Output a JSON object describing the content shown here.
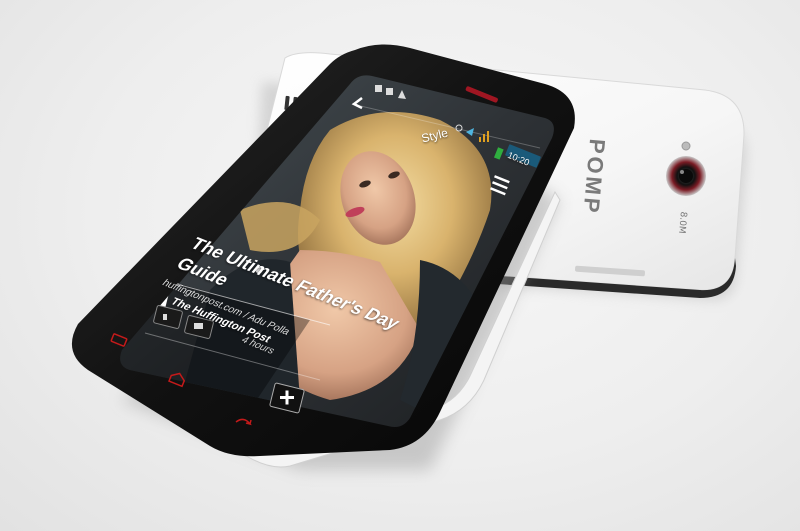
{
  "front_phone": {
    "status_bar": {
      "time": "10:20",
      "icons": [
        "notification-icon",
        "image-icon",
        "warning-icon",
        "alarm-icon",
        "wifi-icon",
        "signal-icon",
        "battery-icon"
      ]
    },
    "app_bar": {
      "back_icon": "back-arrow-icon",
      "section_label": "Style",
      "menu_icon": "hamburger-menu-icon"
    },
    "article": {
      "title_line1": "The Ultimate Father's Day",
      "title_line2": "Guide",
      "source_line": "huffingtonpost.com / Adu Polla",
      "publisher": "The Huffington Post",
      "time_ago": "4 hours",
      "pager_dot_icon": "page-indicator-icon",
      "like_icon": "like-icon",
      "comment_icon": "comment-icon",
      "add_icon": "plus-icon"
    },
    "nav_keys": [
      "menu-key-icon",
      "home-key-icon",
      "back-key-icon"
    ]
  },
  "back_phone": {
    "brand": "POMP",
    "camera_label": "8.0M"
  },
  "colors": {
    "front_bezel": "#111111",
    "back_shell": "#ffffff",
    "nav_key_red": "#c41a1a",
    "status_time_bg": "#1a5a7a"
  }
}
